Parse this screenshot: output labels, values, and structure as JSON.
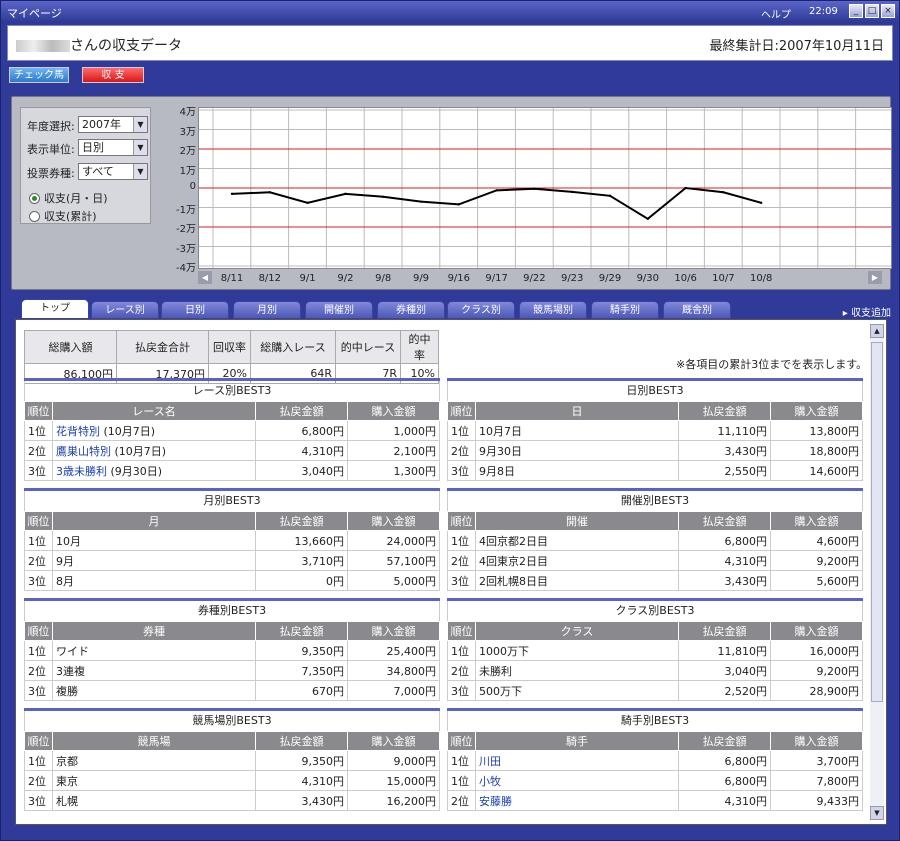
{
  "window": {
    "title": "マイページ",
    "help": "ヘルプ",
    "clock": "22:09",
    "min": "_",
    "max": "□",
    "close": "×"
  },
  "header": {
    "user_suffix": "さんの収支データ",
    "last_calc": "最終集計日:2007年10月11日"
  },
  "nav": {
    "check": "チェック馬",
    "balance": "収 支"
  },
  "controls": {
    "year_label": "年度選択:",
    "year_value": "2007年",
    "unit_label": "表示単位:",
    "unit_value": "日別",
    "bet_label": "投票券種:",
    "bet_value": "すべて",
    "radio1": "収支(月・日)",
    "radio2": "収支(累計)"
  },
  "chart_data": {
    "type": "line",
    "x": [
      "8/11",
      "8/12",
      "9/1",
      "9/2",
      "9/8",
      "9/9",
      "9/16",
      "9/17",
      "9/22",
      "9/23",
      "9/29",
      "9/30",
      "10/6",
      "10/7",
      "10/8"
    ],
    "values": [
      -3000,
      -2200,
      -7600,
      -3000,
      -4500,
      -7000,
      -8400,
      -1200,
      -400,
      -2000,
      -4000,
      -15800,
      0,
      -2200,
      -7600
    ],
    "yticks": [
      "4万",
      "3万",
      "2万",
      "1万",
      "0",
      "-1万",
      "-2万",
      "-3万",
      "-4万"
    ],
    "ylim": [
      -40000,
      40000
    ],
    "series_color": "#000000",
    "guide_color": "#d02020"
  },
  "tabs": [
    "トップ",
    "レース別",
    "日別",
    "月別",
    "開催別",
    "券種別",
    "クラス別",
    "競馬場別",
    "騎手別",
    "厩舎別"
  ],
  "add_link": "▸ 収支追加",
  "summary": {
    "headers": [
      "総購入額",
      "払戻金合計",
      "回収率",
      "総購入レース",
      "的中レース",
      "的中率"
    ],
    "values": [
      "86,100円",
      "17,370円",
      "20%",
      "64R",
      "7R",
      "10%"
    ]
  },
  "note": "※各項目の累計3位までを表示します。",
  "boxes": [
    {
      "title": "レース別BEST3",
      "cols": [
        "順位",
        "レース名",
        "払戻金額",
        "購入金額"
      ],
      "rows": [
        [
          "1位",
          "花背特別",
          "(10月7日)",
          "6,800円",
          "1,000円"
        ],
        [
          "2位",
          "鷹巣山特別",
          "(10月7日)",
          "4,310円",
          "2,100円"
        ],
        [
          "3位",
          "3歳未勝利",
          "(9月30日)",
          "3,040円",
          "1,300円"
        ]
      ],
      "link": true
    },
    {
      "title": "日別BEST3",
      "cols": [
        "順位",
        "日",
        "払戻金額",
        "購入金額"
      ],
      "rows": [
        [
          "1位",
          "10月7日",
          "",
          "11,110円",
          "13,800円"
        ],
        [
          "2位",
          "9月30日",
          "",
          "3,430円",
          "18,800円"
        ],
        [
          "3位",
          "9月8日",
          "",
          "2,550円",
          "14,600円"
        ]
      ]
    },
    {
      "title": "月別BEST3",
      "cols": [
        "順位",
        "月",
        "払戻金額",
        "購入金額"
      ],
      "rows": [
        [
          "1位",
          "10月",
          "",
          "13,660円",
          "24,000円"
        ],
        [
          "2位",
          "9月",
          "",
          "3,710円",
          "57,100円"
        ],
        [
          "3位",
          "8月",
          "",
          "0円",
          "5,000円"
        ]
      ]
    },
    {
      "title": "開催別BEST3",
      "cols": [
        "順位",
        "開催",
        "払戻金額",
        "購入金額"
      ],
      "rows": [
        [
          "1位",
          "4回京都2日目",
          "",
          "6,800円",
          "4,600円"
        ],
        [
          "2位",
          "4回東京2日目",
          "",
          "4,310円",
          "9,200円"
        ],
        [
          "3位",
          "2回札幌8日目",
          "",
          "3,430円",
          "5,600円"
        ]
      ]
    },
    {
      "title": "券種別BEST3",
      "cols": [
        "順位",
        "券種",
        "払戻金額",
        "購入金額"
      ],
      "rows": [
        [
          "1位",
          "ワイド",
          "",
          "9,350円",
          "25,400円"
        ],
        [
          "2位",
          "3連複",
          "",
          "7,350円",
          "34,800円"
        ],
        [
          "3位",
          "複勝",
          "",
          "670円",
          "7,000円"
        ]
      ]
    },
    {
      "title": "クラス別BEST3",
      "cols": [
        "順位",
        "クラス",
        "払戻金額",
        "購入金額"
      ],
      "rows": [
        [
          "1位",
          "1000万下",
          "",
          "11,810円",
          "16,000円"
        ],
        [
          "2位",
          "未勝利",
          "",
          "3,040円",
          "9,200円"
        ],
        [
          "3位",
          "500万下",
          "",
          "2,520円",
          "28,900円"
        ]
      ]
    },
    {
      "title": "競馬場別BEST3",
      "cols": [
        "順位",
        "競馬場",
        "払戻金額",
        "購入金額"
      ],
      "rows": [
        [
          "1位",
          "京都",
          "",
          "9,350円",
          "9,000円"
        ],
        [
          "2位",
          "東京",
          "",
          "4,310円",
          "15,000円"
        ],
        [
          "3位",
          "札幌",
          "",
          "3,430円",
          "16,200円"
        ]
      ]
    },
    {
      "title": "騎手別BEST3",
      "cols": [
        "順位",
        "騎手",
        "払戻金額",
        "購入金額"
      ],
      "rows": [
        [
          "1位",
          "川田",
          "",
          "6,800円",
          "3,700円"
        ],
        [
          "1位",
          "小牧",
          "",
          "6,800円",
          "7,800円"
        ],
        [
          "2位",
          "安藤勝",
          "",
          "4,310円",
          "9,433円"
        ]
      ],
      "link": true
    }
  ]
}
